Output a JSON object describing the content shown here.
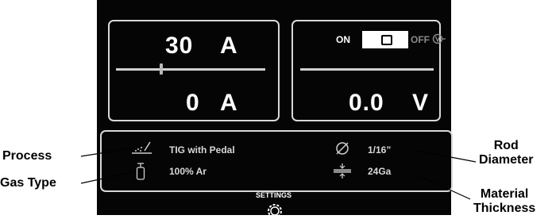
{
  "amperage": {
    "set_value": "30",
    "set_unit": "A",
    "actual_value": "0",
    "actual_unit": "A",
    "slider_fraction": 0.29
  },
  "voltage": {
    "on_label": "ON",
    "off_label": "OFF",
    "actual_value": "0.0",
    "actual_unit": "V"
  },
  "info": {
    "process": "TIG with Pedal",
    "gas": "100% Ar",
    "rod_diameter": "1/16”",
    "material_thickness": "24Ga"
  },
  "settings_label": "SETTINGS",
  "callouts": {
    "process": "Process",
    "gas_type": "Gas Type",
    "rod_diameter": "Rod\nDiameter",
    "material_thickness": "Material\nThickness"
  },
  "icons": [
    "process-icon",
    "gas-bottle-icon",
    "diameter-icon",
    "thickness-icon",
    "voltage-sense-icon",
    "gear-icon"
  ]
}
